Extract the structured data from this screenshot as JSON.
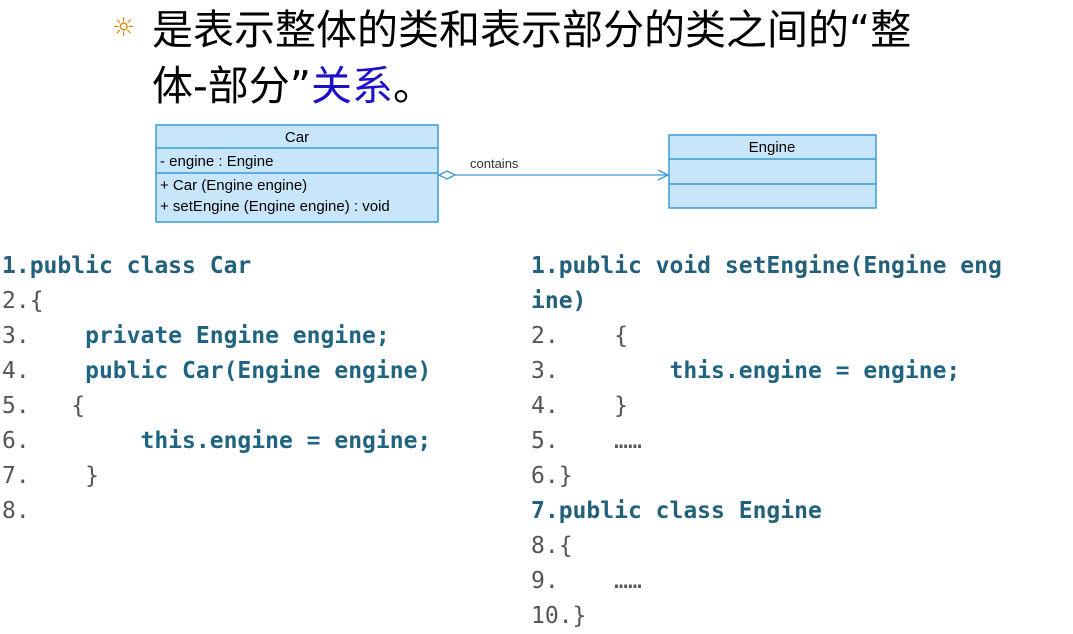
{
  "heading": {
    "bullet_icon": "sun-icon",
    "line1": "是表示整体的类和表示部分的类之间的“整",
    "line2_prefix": "体-部分”",
    "line2_highlight": "关系",
    "line2_suffix": "。",
    "highlight_color": "#1c10c8"
  },
  "diagram": {
    "car": {
      "name": "Car",
      "attributes": [
        "-  engine  : Engine"
      ],
      "operations": [
        "+  Car (Engine engine)",
        "+  setEngine (Engine engine)  : void"
      ]
    },
    "engine": {
      "name": "Engine"
    },
    "relation_label": "contains",
    "relation_type": "aggregation",
    "box_fill": "#c8e6f9",
    "box_stroke": "#3b9ad9"
  },
  "code_left": [
    {
      "num": "1.",
      "text": "public class Car",
      "style": "txt"
    },
    {
      "num": "2.",
      "text": "{",
      "style": "plain"
    },
    {
      "num": "3.",
      "text": "    private Engine engine;",
      "style": "kw"
    },
    {
      "num": "4.",
      "text": "    public Car(Engine engine)",
      "style": "kw"
    },
    {
      "num": "5.",
      "text": "   {",
      "style": "plain"
    },
    {
      "num": "6.",
      "text": "        this.engine = engine;",
      "style": "kw"
    },
    {
      "num": "7.",
      "text": "    }",
      "style": "plain"
    },
    {
      "num": "8.",
      "text": "",
      "style": "plain"
    }
  ],
  "code_right": [
    {
      "num": "1.",
      "text": "public void setEngine(Engine eng",
      "style": "txt"
    },
    {
      "num": "",
      "text": "ine)",
      "style": "txt"
    },
    {
      "num": "2.",
      "text": "    {",
      "style": "plain"
    },
    {
      "num": "3.",
      "text": "        this.engine = engine;",
      "style": "kw"
    },
    {
      "num": "4.",
      "text": "    }",
      "style": "plain"
    },
    {
      "num": "5.",
      "text": "    ……",
      "style": "plain"
    },
    {
      "num": "6.",
      "text": "}",
      "style": "plain"
    },
    {
      "num": "7.",
      "text": "public class Engine",
      "style": "txt"
    },
    {
      "num": "8.",
      "text": "{",
      "style": "plain"
    },
    {
      "num": "9.",
      "text": "    ……",
      "style": "plain"
    },
    {
      "num": "10.",
      "text": "}",
      "style": "plain"
    }
  ]
}
